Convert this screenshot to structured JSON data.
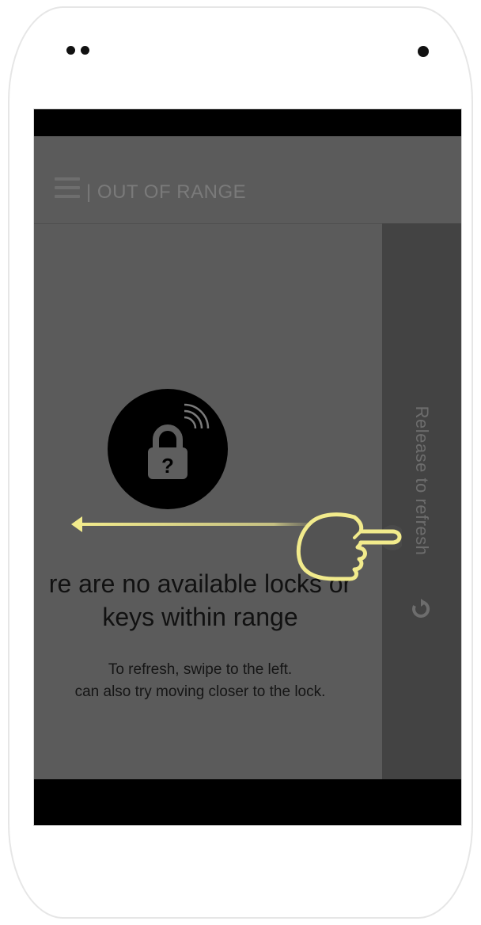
{
  "app_bar": {
    "menu_icon": "hamburger-menu-icon",
    "title": "| OUT OF RANGE"
  },
  "refresh_panel": {
    "label": "Release to refresh",
    "icon": "refresh-icon"
  },
  "lock_status": {
    "icon": "lock-question-signal-icon",
    "glyph": "?"
  },
  "empty_state": {
    "message_line1": "re are no available locks or",
    "message_line2": "keys within range",
    "hint_line1": "To refresh, swipe to the left.",
    "hint_line2": "can also try moving closer to the lock."
  },
  "gesture_hint": {
    "hand_icon": "pointing-hand-icon",
    "arrow_icon": "swipe-left-arrow-icon",
    "color": "#f2eb8c"
  },
  "colors": {
    "app_background": "#5b5b5b",
    "panel_background": "#434343",
    "screen_frame": "#000000"
  }
}
